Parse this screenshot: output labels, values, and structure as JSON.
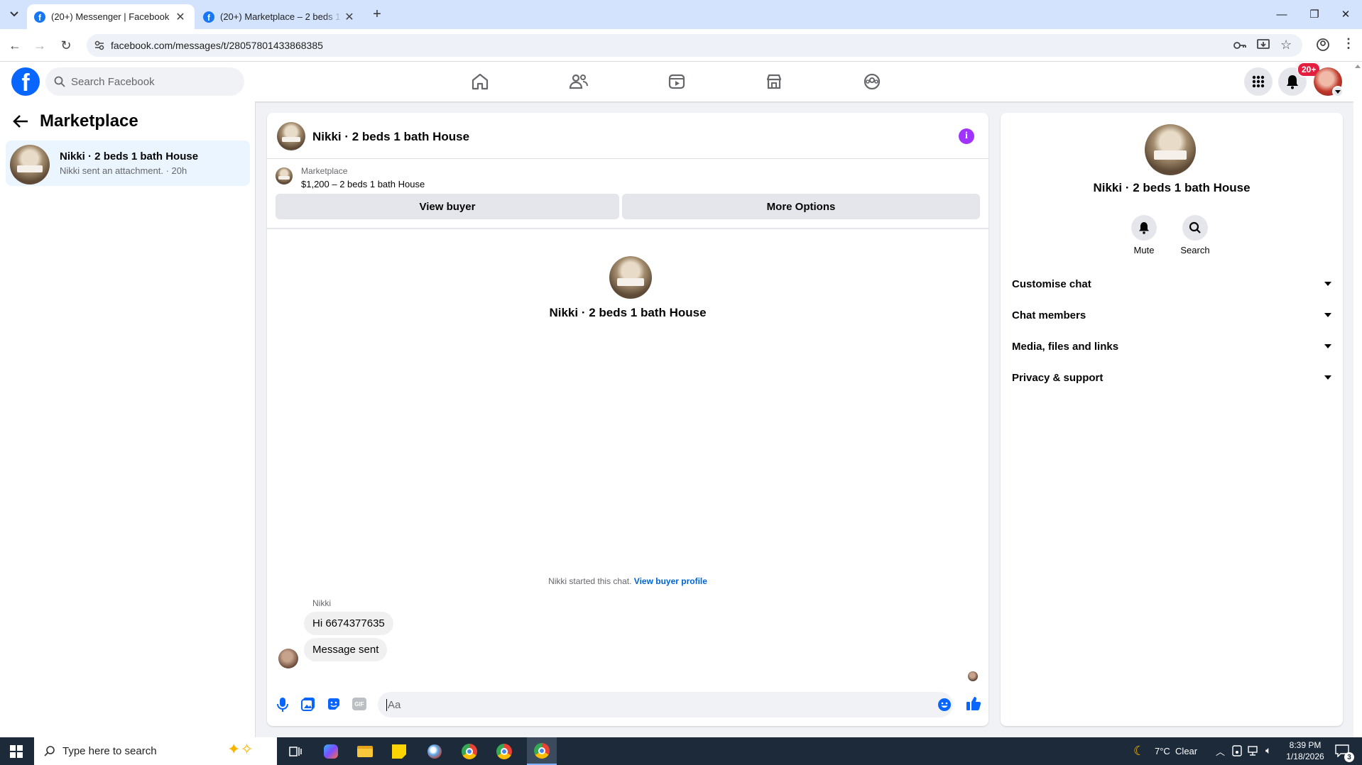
{
  "browser": {
    "tabs": [
      {
        "title": "(20+) Messenger | Facebook",
        "active": true
      },
      {
        "title": "(20+) Marketplace – 2 beds 1 b",
        "active": false
      }
    ],
    "url": "facebook.com/messages/t/28057801433868385"
  },
  "fb": {
    "search_placeholder": "Search Facebook",
    "notification_badge": "20+"
  },
  "sidebar": {
    "title": "Marketplace",
    "chats": [
      {
        "name": "Nikki · 2 beds 1 bath House",
        "preview": "Nikki sent an attachment.",
        "time": "20h"
      }
    ]
  },
  "chat": {
    "header_title": "Nikki · 2 beds 1 bath House",
    "listing": {
      "source": "Marketplace",
      "summary": "$1,200 – 2 beds 1 bath House"
    },
    "buttons": {
      "view_buyer": "View buyer",
      "more_options": "More Options"
    },
    "intro_name": "Nikki · 2 beds 1 bath House",
    "started_text": "Nikki started this chat.",
    "view_buyer_profile": "View buyer profile",
    "sender": "Nikki",
    "messages": [
      "Hi 6674377635",
      "Message sent"
    ],
    "composer_placeholder": "Aa"
  },
  "info": {
    "name": "Nikki · 2 beds 1 bath House",
    "actions": [
      "Mute",
      "Search"
    ],
    "sections": [
      "Customise chat",
      "Chat members",
      "Media, files and links",
      "Privacy & support"
    ]
  },
  "taskbar": {
    "search_placeholder": "Type here to search",
    "weather": "7°C  Clear",
    "time": "8:39 PM",
    "date": "1/18/2026",
    "notif_count": "3"
  },
  "colors": {
    "fb_blue": "#0866ff",
    "accent_purple": "#a033ff",
    "link": "#0064d1"
  }
}
